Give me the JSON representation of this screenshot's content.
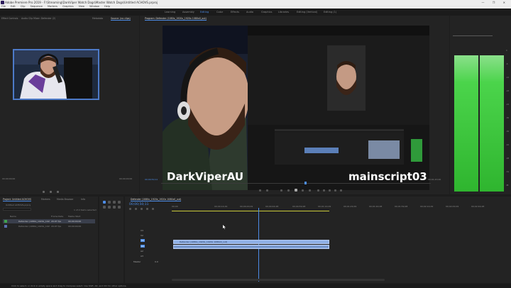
{
  "app": {
    "title": "Adobe Premiere Pro 2019 - F:\\Streaming\\DarkViper Watch Dogs\\Master Watch Dogs\\Untitled ACHOVS.prproj",
    "window_controls": "—  ❐  ✕"
  },
  "menu": [
    "File",
    "Edit",
    "Clip",
    "Sequence",
    "Markers",
    "Graphics",
    "View",
    "Window",
    "Help"
  ],
  "workspaces": [
    {
      "label": "Learning",
      "active": false
    },
    {
      "label": "Assembly",
      "active": false
    },
    {
      "label": "Editing",
      "active": true
    },
    {
      "label": "Color",
      "active": false
    },
    {
      "label": "Effects",
      "active": false
    },
    {
      "label": "Audio",
      "active": false
    },
    {
      "label": "Graphics",
      "active": false
    },
    {
      "label": "Libraries",
      "active": false
    },
    {
      "label": "Editing (Vertical)",
      "active": false
    },
    {
      "label": "Editing (1)",
      "active": false
    }
  ],
  "source_panel": {
    "tabs": [
      {
        "label": "Effect Controls",
        "active": false
      },
      {
        "label": "Audio Clip Mixer: Defender (2)",
        "active": false
      },
      {
        "label": "Metadata",
        "active": false
      },
      {
        "label": "Source: (no clips)",
        "active": true
      }
    ],
    "timecode_left": "00;00;00;00",
    "timecode_right": "00;00;00;00"
  },
  "program_panel": {
    "tab": "Program: Defender (1080x_1920x_1920x 1080x0_out)",
    "timecode_left": "00;00;50;11",
    "fit_label": "Fit",
    "quality_label": "Full",
    "timecode_right": "00;01;43;20"
  },
  "overlay": {
    "name_left": "DarkViperAU",
    "name_right": "mainscript03"
  },
  "project_panel": {
    "tabs": [
      {
        "label": "Project: Untitled ACHOVS",
        "active": true
      },
      {
        "label": "Markers",
        "active": false
      },
      {
        "label": "Media Browser",
        "active": false
      },
      {
        "label": "Info",
        "active": false
      }
    ],
    "path": "Untitled ACHOVS.prproj",
    "items_count": "1 of 2 items selected",
    "columns": [
      "Name",
      "Frame Rate",
      "Media Start"
    ],
    "rows": [
      {
        "name": "Defender (1080x_1920x_1920x 1080x0_out)",
        "fps": "29.97 fps",
        "start": "00;00;00;00"
      },
      {
        "name": "Defender (1080x_1920x_1920x 1080x0).mp4",
        "fps": "29.97 fps",
        "start": "00;00;00;00"
      }
    ]
  },
  "timeline": {
    "tab": "Defender (1080x_1920x_1920x 1080x0_out)",
    "timecode": "00;00;50;11",
    "ruler": [
      "00;00",
      "00;00;14;29",
      "00;00;29;29",
      "00;00;44;28",
      "00;00;59;28",
      "00;01;14;29",
      "00;01;29;29",
      "00;01;44;28",
      "00;01;59;28",
      "00;02;14;29",
      "00;02;29;29",
      "00;02;44;28"
    ],
    "tracks": [
      "V3",
      "V2",
      "V1",
      "A1",
      "A2",
      "A3",
      "Master"
    ],
    "master_value": "0.0",
    "clip_label": "Defender (1080x_1920x_1920x 1080x0_out)"
  },
  "status_bar": "Click to select, or click in empty space and drag to marquee select. Use Shift, Alt, and Ctrl for other options.",
  "meter_db": [
    "0",
    "-6",
    "-12",
    "-18",
    "-24",
    "-30",
    "-36",
    "-42",
    "-48",
    "-54",
    "dB"
  ],
  "colors": {
    "accent": "#4d8de8",
    "clip_video": "#8fb0e6",
    "meter_green": "#4bd44b"
  },
  "icons": [
    "adobe-logo-icon",
    "play-icon",
    "step-back-icon",
    "step-forward-icon",
    "wrench-icon",
    "razor-icon",
    "selection-tool-icon",
    "marker-icon",
    "export-frame-icon"
  ]
}
